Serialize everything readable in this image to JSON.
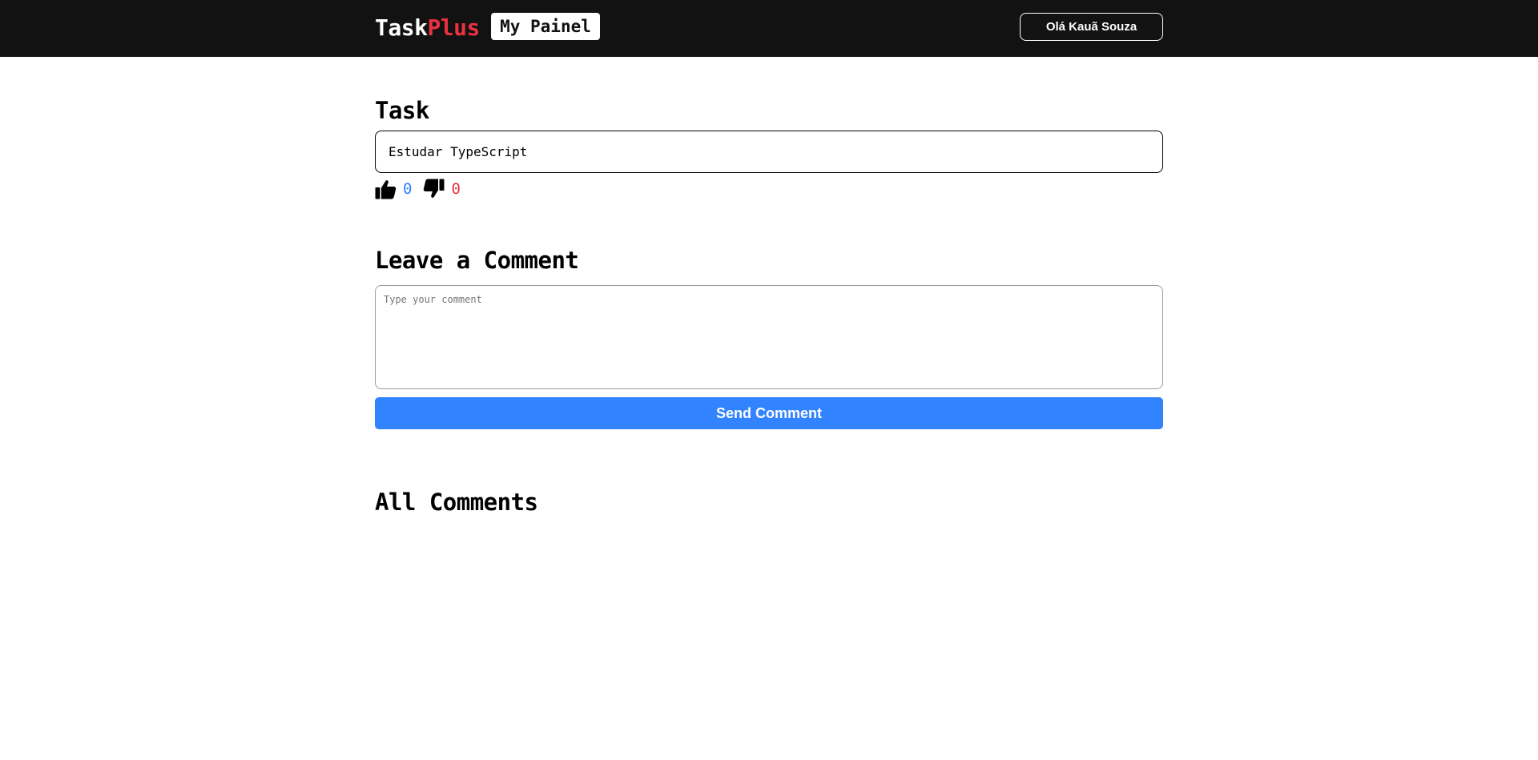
{
  "header": {
    "logo_main": "Task",
    "logo_accent": "Plus",
    "panel_label": "My Painel",
    "user_label": "Olá Kauã Souza"
  },
  "task": {
    "heading": "Task",
    "text": "Estudar TypeScript",
    "likes": "0",
    "dislikes": "0"
  },
  "comment": {
    "heading": "Leave a Comment",
    "placeholder": "Type your comment",
    "send_label": "Send Comment"
  },
  "comments": {
    "heading": "All Comments"
  },
  "colors": {
    "header_bg": "#121212",
    "accent_red": "#ea3140",
    "button_blue": "#3183ff",
    "like_blue": "#3183ff",
    "dislike_red": "#ea3140"
  }
}
